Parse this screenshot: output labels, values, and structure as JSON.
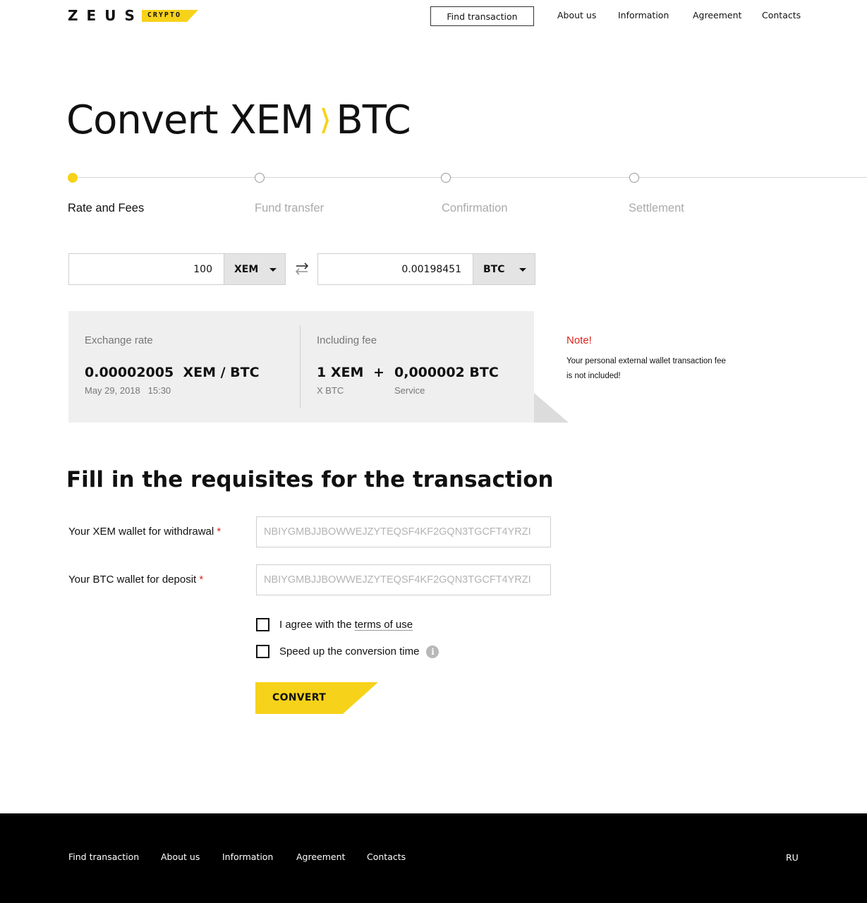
{
  "header": {
    "logo_letters": [
      "Z",
      "E",
      "U",
      "S"
    ],
    "logo_badge": "CRYPTO",
    "find_transaction": "Find transaction",
    "nav": [
      "About us",
      "Information",
      "Agreement",
      "Contacts"
    ]
  },
  "title": {
    "prefix": "Convert",
    "from": "XEM",
    "to": "BTC",
    "arrow_color": "#f7d21a"
  },
  "steps": [
    {
      "label": "Rate and Fees",
      "active": true
    },
    {
      "label": "Fund transfer",
      "active": false
    },
    {
      "label": "Confirmation",
      "active": false
    },
    {
      "label": "Settlement",
      "active": false
    }
  ],
  "converter": {
    "from_amount": "100",
    "from_currency": "XEM",
    "to_amount": "0.00198451",
    "to_currency": "BTC"
  },
  "rate": {
    "exchange_label": "Exchange rate",
    "exchange_value": "0.00002005",
    "exchange_pair": "XEM / BTC",
    "date": "May 29, 2018",
    "time": "15:30",
    "fee_label": "Including fee",
    "fee_part1": "1 XEM",
    "fee_plus": "+",
    "fee_part2": "0,000002 BTC",
    "fee_sub1": "X BTC",
    "fee_sub2": "Service"
  },
  "note": {
    "title": "Note!",
    "text": "Your personal external wallet transaction fee is not included!"
  },
  "form": {
    "title": "Fill in the requisites for the transaction",
    "xem_label": "Your XEM wallet for withdrawal",
    "btc_label": "Your BTC wallet for deposit",
    "required_mark": "*",
    "xem_placeholder": "NBIYGMBJJBOWWEJZYTEQSF4KF2GQN3TGCFT4YRZI",
    "btc_placeholder": "NBIYGMBJJBOWWEJZYTEQSF4KF2GQN3TGCFT4YRZI",
    "agree_text": "I agree with the",
    "terms_link": "terms of use",
    "speed_text": "Speed up the conversion time",
    "info_glyph": "i",
    "convert_label": "CONVERT"
  },
  "footer": {
    "links": [
      "Find transaction",
      "About us",
      "Information",
      "Agreement",
      "Contacts"
    ],
    "lang": "RU"
  },
  "colors": {
    "accent": "#f7d21a",
    "error": "#d9261c",
    "panel": "#efefef",
    "footer_bg": "#000000"
  }
}
